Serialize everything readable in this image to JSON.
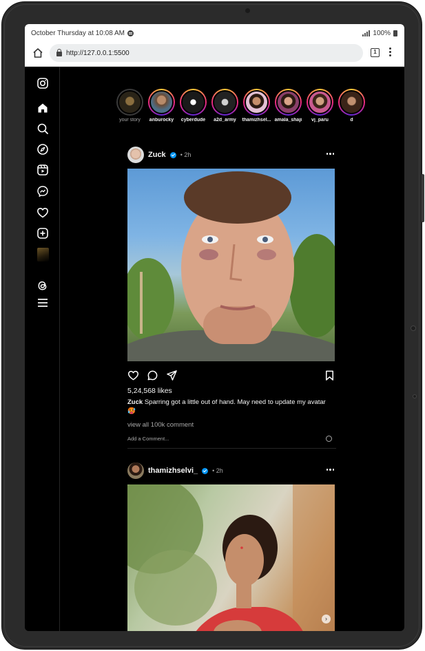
{
  "status_bar": {
    "time_text": "October Thursday at 10:08 AM",
    "battery": "100%"
  },
  "browser": {
    "url": "http://127.0.0.1:5500",
    "tab_count": "1"
  },
  "sidebar": {
    "items": [
      "instagram-logo",
      "home",
      "search",
      "explore",
      "reels",
      "messages",
      "notifications",
      "create",
      "profile",
      "threads",
      "more"
    ]
  },
  "stories": [
    {
      "name": "your story",
      "seen": true
    },
    {
      "name": "anburocky"
    },
    {
      "name": "cyberdude"
    },
    {
      "name": "a2d_army"
    },
    {
      "name": "thamizhsel..."
    },
    {
      "name": "amala_shaji"
    },
    {
      "name": "vj_paru"
    },
    {
      "name": "d"
    }
  ],
  "posts": [
    {
      "author": "Zuck",
      "time": "• 2h",
      "likes": "5,24,568 likes",
      "caption_author": "Zuck",
      "caption_text": "Sparring got a little out of hand. May need to update my avatar 🥵",
      "view_comments": "view all 100k comment",
      "add_comment_placeholder": "Add a Comment..."
    },
    {
      "author": "thamizhselvi_",
      "time": "• 2h"
    }
  ],
  "colors": {
    "background": "#000000",
    "verified": "#0095f6",
    "muted_text": "#a8a8a8"
  }
}
